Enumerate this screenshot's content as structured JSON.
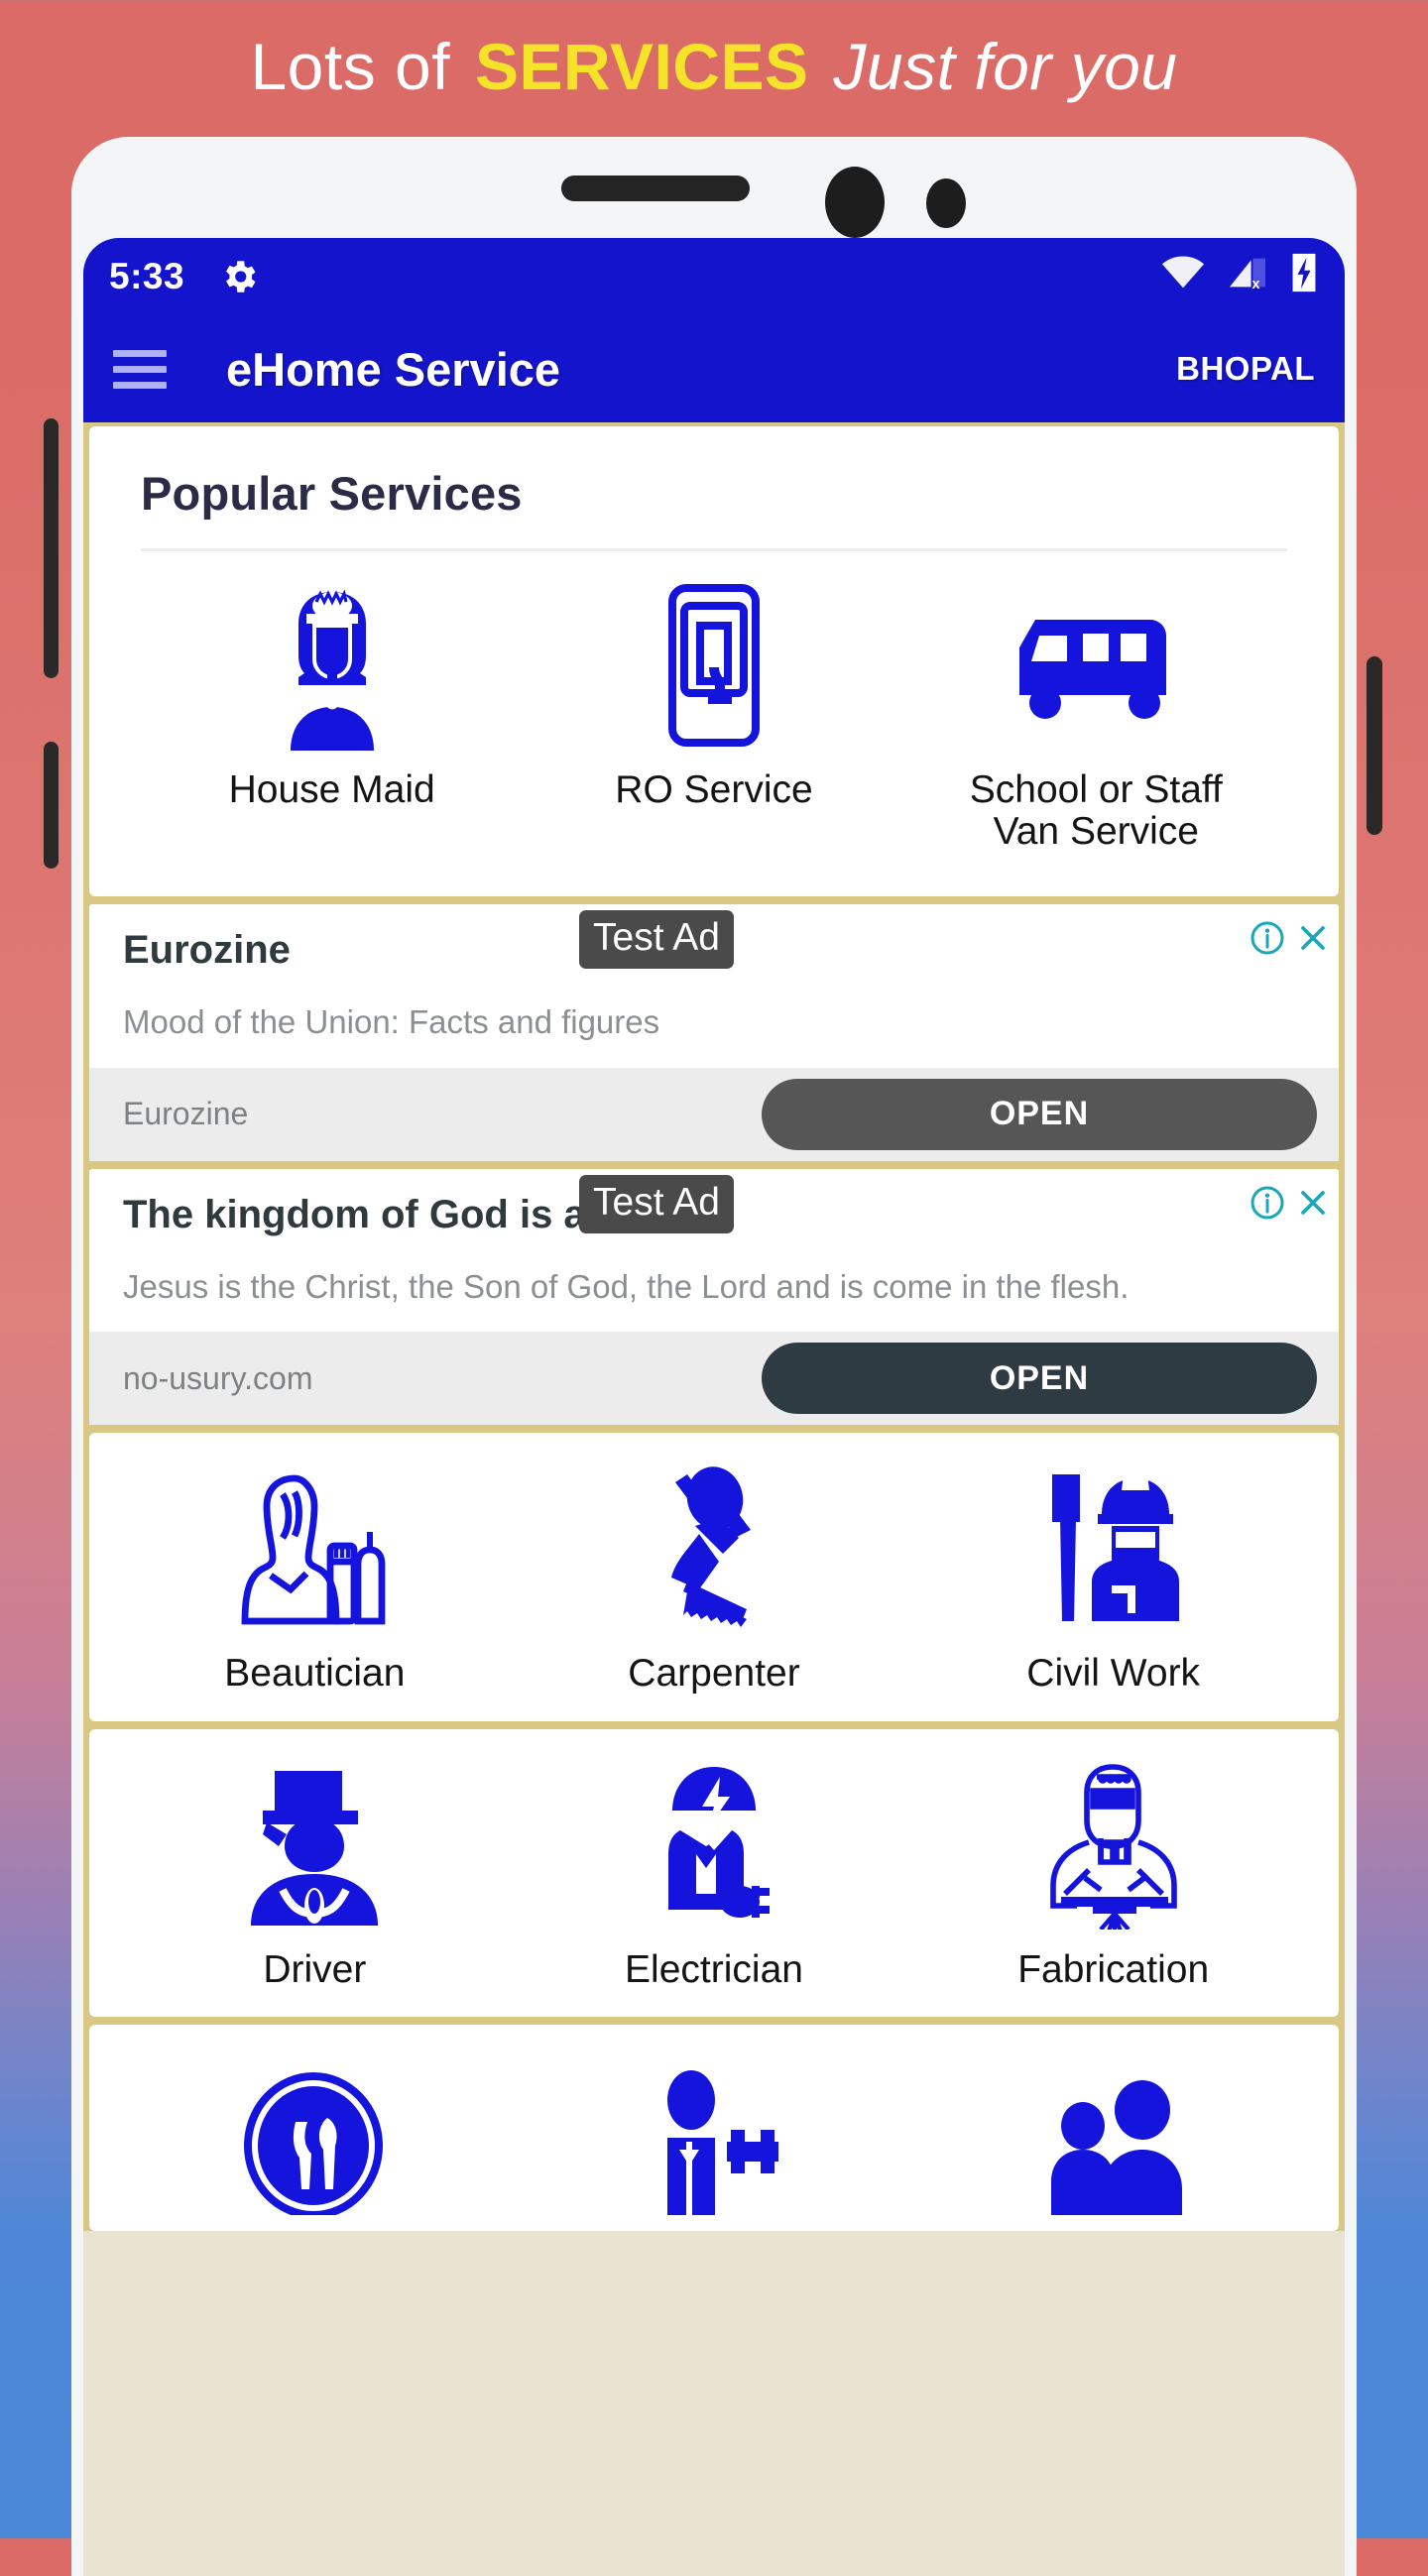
{
  "banner": {
    "prefix": "Lots of ",
    "highlight": "SERVICES",
    "suffix": "Just for you"
  },
  "colors": {
    "brand_blue": "#1414cc",
    "banner_highlight": "#f5e32a",
    "card_frame_gold": "#d8c884",
    "background_top": "#da6b66",
    "background_bottom": "#4a87d6",
    "ad_info_teal": "#1aa7b8"
  },
  "status_bar": {
    "time": "5:33",
    "gear_icon": "gear-icon",
    "wifi_icon": "wifi-icon",
    "signal_icon": "cellular-signal-off-icon",
    "battery_icon": "battery-charging-icon"
  },
  "app_bar": {
    "menu_icon": "hamburger-menu-icon",
    "title": "eHome Service",
    "city": "BHOPAL"
  },
  "popular": {
    "heading": "Popular Services",
    "items": [
      {
        "label": "House Maid",
        "icon": "house-maid-icon"
      },
      {
        "label": "RO Service",
        "icon": "ro-water-purifier-icon"
      },
      {
        "label": "School or Staff Van Service",
        "icon": "van-icon"
      }
    ]
  },
  "ads": [
    {
      "headline": "Eurozine",
      "description": "Mood of the Union: Facts and figures",
      "domain": "Eurozine",
      "cta": "OPEN",
      "badge": "Test Ad",
      "cta_color": "#565656",
      "info_icon": "ad-info-icon",
      "close_icon": "ad-close-icon"
    },
    {
      "headline": "The kingdom of God is a",
      "description": "Jesus is the Christ, the Son of God, the Lord and is come in the flesh.",
      "domain": "no-usury.com",
      "cta": "OPEN",
      "badge": "Test Ad",
      "cta_color": "#2f3b42",
      "info_icon": "ad-info-icon",
      "close_icon": "ad-close-icon"
    }
  ],
  "service_rows": [
    {
      "items": [
        {
          "label": "Beautician",
          "icon": "beautician-icon"
        },
        {
          "label": "Carpenter",
          "icon": "carpenter-icon"
        },
        {
          "label": "Civil Work",
          "icon": "civil-work-icon"
        }
      ]
    },
    {
      "items": [
        {
          "label": "Driver",
          "icon": "driver-icon"
        },
        {
          "label": "Electrician",
          "icon": "electrician-icon"
        },
        {
          "label": "Fabrication",
          "icon": "fabrication-welder-icon"
        }
      ]
    },
    {
      "items": [
        {
          "label": "",
          "icon": "cook-icon"
        },
        {
          "label": "",
          "icon": "furniture-icon"
        },
        {
          "label": "",
          "icon": "group-icon"
        }
      ]
    }
  ],
  "hardware": {
    "volume_up": "volume-up-button",
    "volume_down": "volume-down-button",
    "power": "power-button",
    "speaker": "earpiece-speaker",
    "camera": "front-camera"
  }
}
